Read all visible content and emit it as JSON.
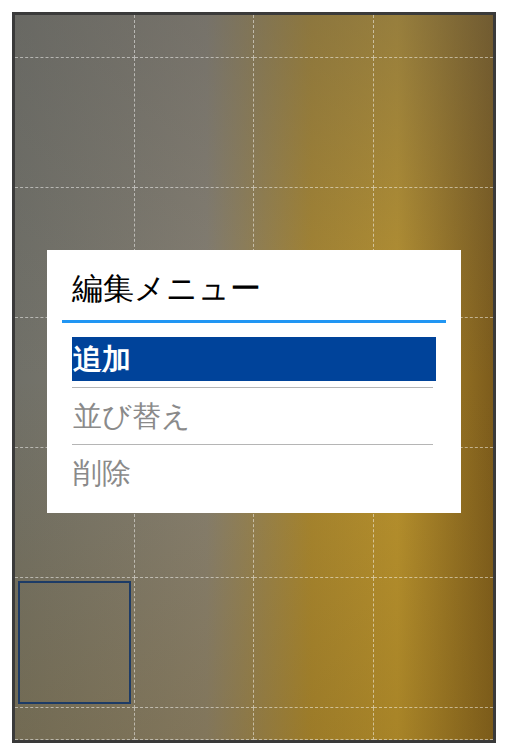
{
  "menu": {
    "title": "編集メニュー",
    "items": [
      {
        "label": "追加",
        "selected": true,
        "disabled": false
      },
      {
        "label": "並び替え",
        "selected": false,
        "disabled": true
      },
      {
        "label": "削除",
        "selected": false,
        "disabled": true
      }
    ]
  },
  "grid": {
    "cells": [
      {
        "selected": false
      },
      {
        "selected": false
      },
      {
        "selected": false
      },
      {
        "selected": false
      },
      {
        "selected": false
      },
      {
        "selected": false
      },
      {
        "selected": false
      },
      {
        "selected": false
      },
      {
        "selected": false
      },
      {
        "selected": false
      },
      {
        "selected": false
      },
      {
        "selected": false
      },
      {
        "selected": false
      },
      {
        "selected": false
      },
      {
        "selected": false
      },
      {
        "selected": false
      },
      {
        "selected": false
      },
      {
        "selected": false
      },
      {
        "selected": false
      },
      {
        "selected": false
      },
      {
        "selected": true
      },
      {
        "selected": false
      },
      {
        "selected": false
      },
      {
        "selected": false
      },
      {
        "selected": false
      },
      {
        "selected": false
      },
      {
        "selected": false
      },
      {
        "selected": false
      }
    ]
  }
}
